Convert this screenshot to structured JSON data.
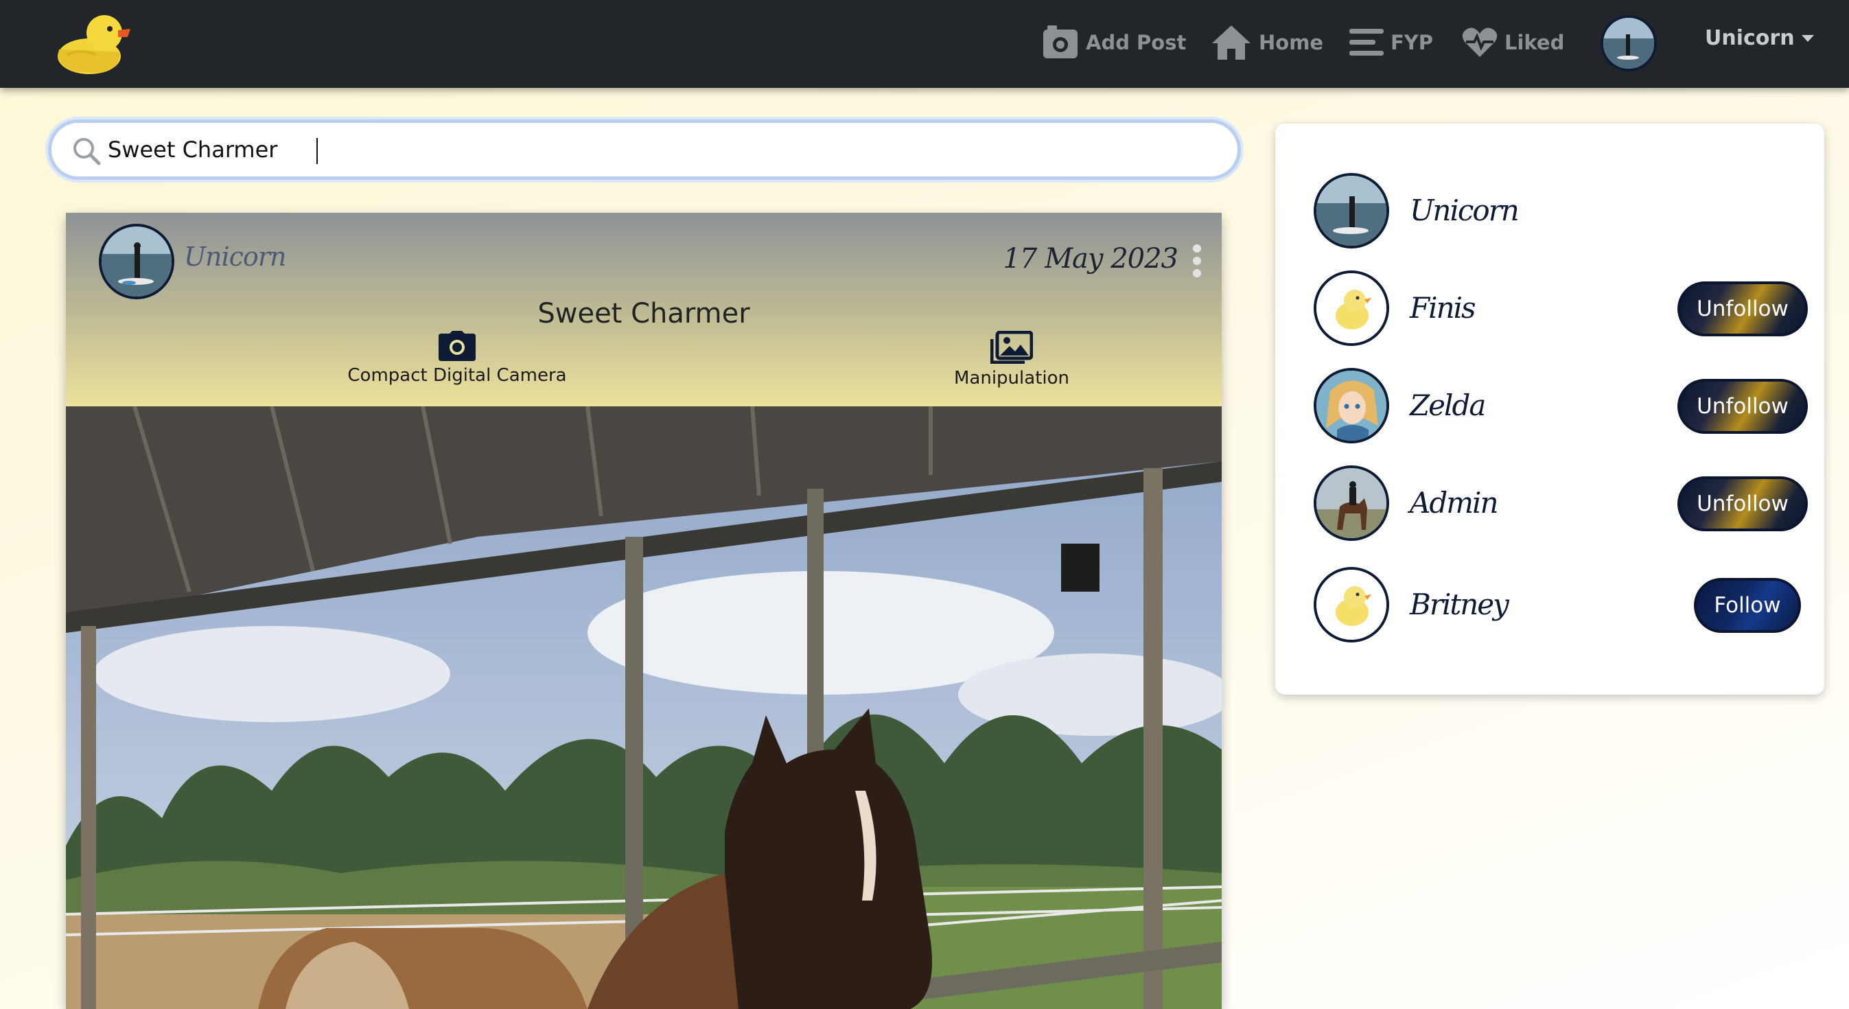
{
  "nav": {
    "add_post": "Add Post",
    "home": "Home",
    "fyp": "FYP",
    "liked": "Liked",
    "username": "Unicorn",
    "logo_icon": "rubber-duck-icon"
  },
  "search": {
    "value": "Sweet Charmer",
    "icon": "search-icon"
  },
  "post": {
    "username": "Unicorn",
    "date": "17 May 2023",
    "title": "Sweet Charmer",
    "tags": [
      {
        "label": "Compact Digital Camera",
        "icon": "camera-icon"
      },
      {
        "label": "Manipulation",
        "icon": "images-icon"
      }
    ]
  },
  "sidebar": {
    "profiles": [
      {
        "name": "Unicorn",
        "button": ""
      },
      {
        "name": "Finis",
        "button": "Unfollow"
      },
      {
        "name": "Zelda",
        "button": "Unfollow"
      },
      {
        "name": "Admin",
        "button": "Unfollow"
      },
      {
        "name": "Britney",
        "button": "Follow"
      }
    ]
  },
  "colors": {
    "navbar": "#22262b",
    "nav_text": "#8d9196",
    "accent_navy": "#0d1b34",
    "unfollow_gold": "#b58d1e",
    "follow_blue": "#0f2760"
  }
}
